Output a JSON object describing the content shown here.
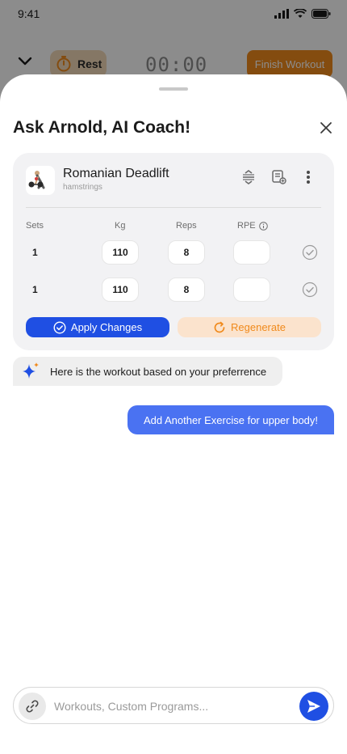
{
  "status_bar": {
    "time": "9:41",
    "icons": [
      "signal-icon",
      "wifi-icon",
      "battery-icon"
    ]
  },
  "workout_bar": {
    "collapse_icon": "chevron-down-icon",
    "rest_label": "Rest",
    "rest_icon": "stopwatch-icon",
    "timer": "00:00",
    "finish_label": "Finish Workout"
  },
  "sheet": {
    "title": "Ask Arnold, AI Coach!",
    "close_icon": "close-icon"
  },
  "exercise_card": {
    "name": "Romanian Deadlift",
    "muscle": "hamstrings",
    "icons": [
      "reorder-icon",
      "notes-icon",
      "more-icon"
    ],
    "columns": {
      "sets": "Sets",
      "kg": "Kg",
      "reps": "Reps",
      "rpe": "RPE"
    },
    "rows": [
      {
        "set": "1",
        "kg": "110",
        "reps": "8",
        "rpe": ""
      },
      {
        "set": "1",
        "kg": "110",
        "reps": "8",
        "rpe": ""
      }
    ],
    "apply_label": "Apply Changes",
    "regenerate_label": "Regenerate"
  },
  "chat": {
    "ai_message": "Here is the workout based on your preferrence",
    "user_message": "Add Another Exercise for upper body!"
  },
  "composer": {
    "placeholder": "Workouts, Custom Programs...",
    "value": ""
  },
  "colors": {
    "accent_blue": "#1f4fe3",
    "user_bubble": "#4a72f2",
    "accent_orange": "#f08a1c",
    "regenerate_bg": "#fbe3cd"
  }
}
